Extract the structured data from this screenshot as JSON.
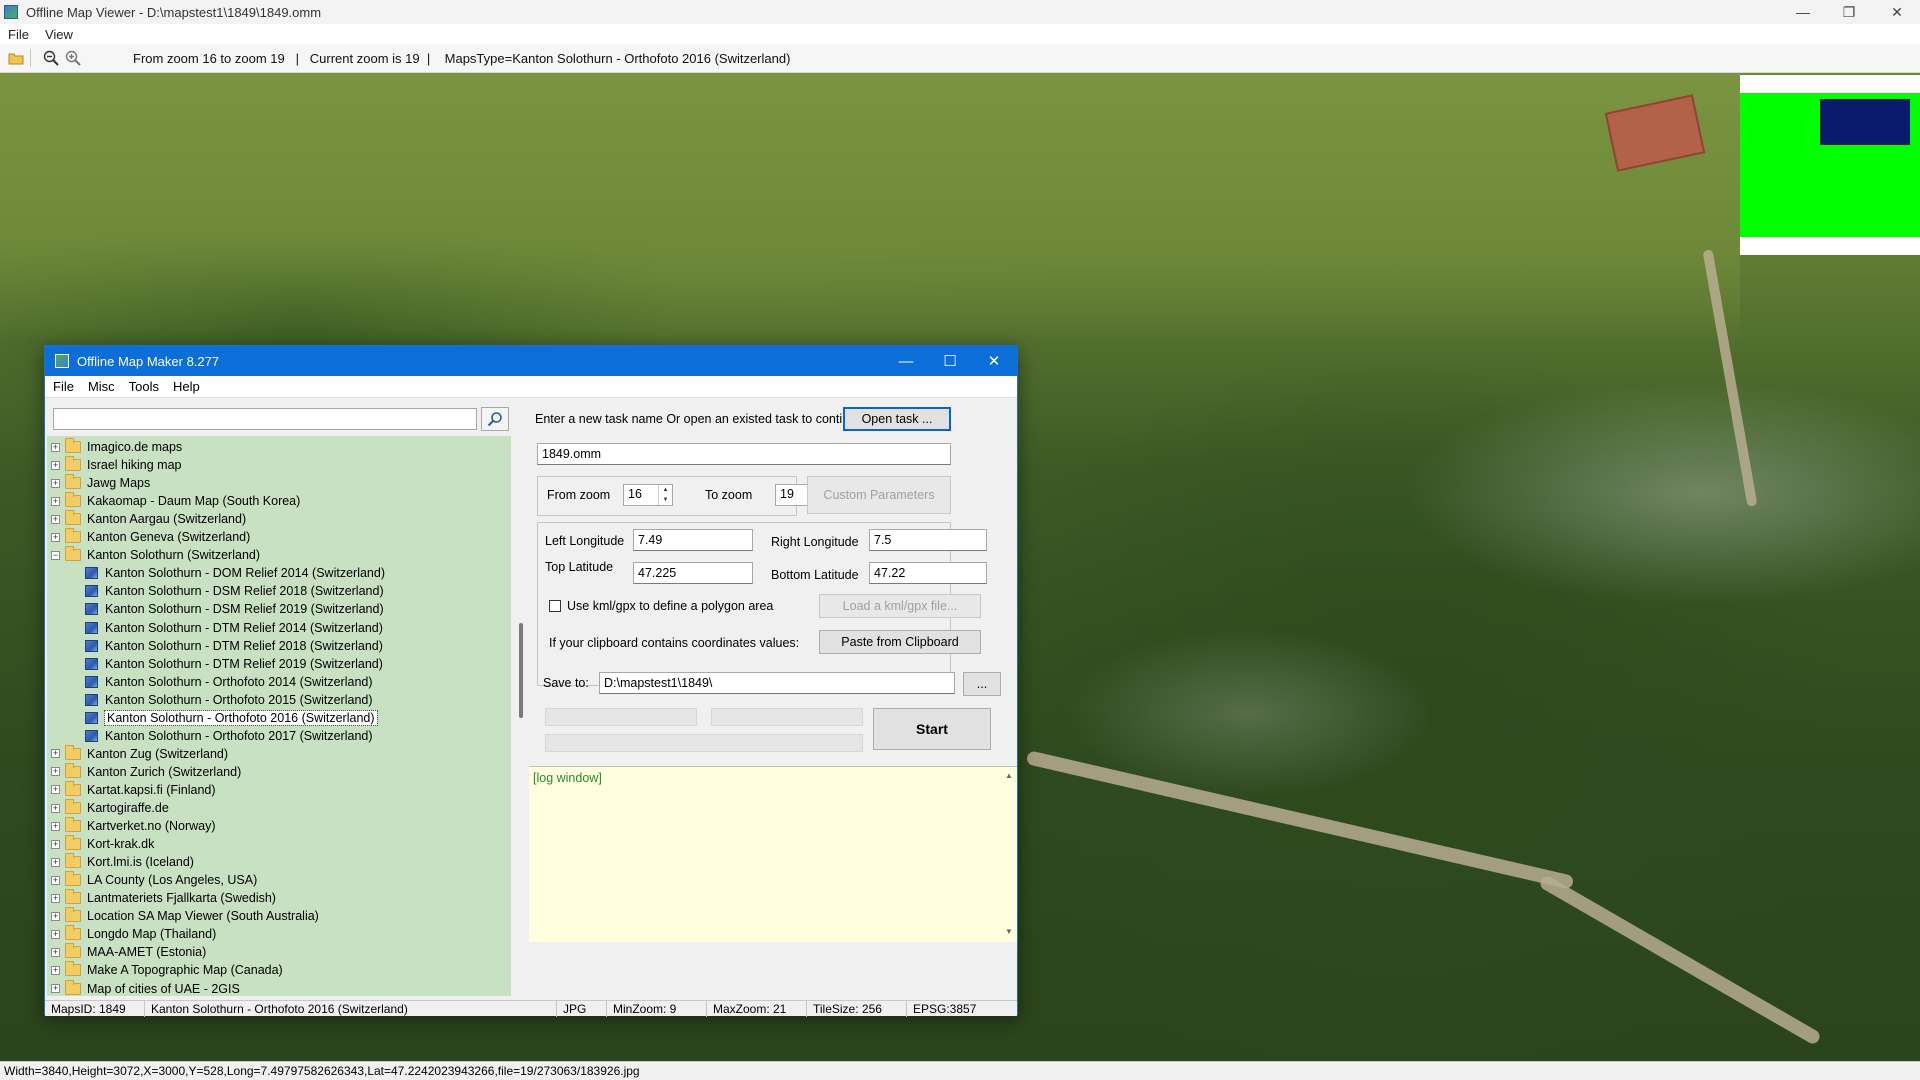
{
  "window": {
    "title": "Offline Map Viewer - D:\\mapstest1\\1849\\1849.omm",
    "menu": [
      "File",
      "View"
    ]
  },
  "toolbar": {
    "icons": [
      "open-folder-icon",
      "zoom-out-icon",
      "zoom-in-icon"
    ],
    "status_text": "From zoom 16 to zoom 19   |   Current zoom is 19  |    MapsType=Kanton Solothurn - Orthofoto 2016 (Switzerland)"
  },
  "map": {
    "minimap_colors": {
      "frame": "#00ff00",
      "viewport": "#0c1a6e"
    }
  },
  "statusbar": {
    "text": "Width=3840,Height=3072,X=3000,Y=528,Long=7.49797582626343,Lat=47.2242023943266,file=19/273063/183926.jpg"
  },
  "dialog": {
    "title": "Offline Map Maker 8.277",
    "menu": [
      "File",
      "Misc",
      "Tools",
      "Help"
    ],
    "search": {
      "value": "",
      "placeholder": ""
    },
    "tree": [
      {
        "label": "Imagico.de maps",
        "type": "folder",
        "level": 0,
        "expanded": false
      },
      {
        "label": "Israel hiking map",
        "type": "folder",
        "level": 0,
        "expanded": false
      },
      {
        "label": "Jawg Maps",
        "type": "folder",
        "level": 0,
        "expanded": false
      },
      {
        "label": "Kakaomap - Daum Map (South Korea)",
        "type": "folder",
        "level": 0,
        "expanded": false
      },
      {
        "label": "Kanton Aargau (Switzerland)",
        "type": "folder",
        "level": 0,
        "expanded": false
      },
      {
        "label": "Kanton Geneva (Switzerland)",
        "type": "folder",
        "level": 0,
        "expanded": false
      },
      {
        "label": "Kanton Solothurn (Switzerland)",
        "type": "folder",
        "level": 0,
        "expanded": true
      },
      {
        "label": "Kanton Solothurn - DOM Relief 2014 (Switzerland)",
        "type": "map",
        "level": 1
      },
      {
        "label": "Kanton Solothurn - DSM Relief 2018 (Switzerland)",
        "type": "map",
        "level": 1
      },
      {
        "label": "Kanton Solothurn - DSM Relief 2019 (Switzerland)",
        "type": "map",
        "level": 1
      },
      {
        "label": "Kanton Solothurn - DTM Relief 2014 (Switzerland)",
        "type": "map",
        "level": 1
      },
      {
        "label": "Kanton Solothurn - DTM Relief 2018 (Switzerland)",
        "type": "map",
        "level": 1
      },
      {
        "label": "Kanton Solothurn - DTM Relief 2019 (Switzerland)",
        "type": "map",
        "level": 1
      },
      {
        "label": "Kanton Solothurn - Orthofoto 2014 (Switzerland)",
        "type": "map",
        "level": 1
      },
      {
        "label": "Kanton Solothurn - Orthofoto 2015 (Switzerland)",
        "type": "map",
        "level": 1
      },
      {
        "label": "Kanton Solothurn - Orthofoto 2016 (Switzerland)",
        "type": "map",
        "level": 1,
        "selected": true
      },
      {
        "label": "Kanton Solothurn - Orthofoto 2017 (Switzerland)",
        "type": "map",
        "level": 1
      },
      {
        "label": "Kanton Zug (Switzerland)",
        "type": "folder",
        "level": 0,
        "expanded": false
      },
      {
        "label": "Kanton Zurich (Switzerland)",
        "type": "folder",
        "level": 0,
        "expanded": false
      },
      {
        "label": "Kartat.kapsi.fi (Finland)",
        "type": "folder",
        "level": 0,
        "expanded": false
      },
      {
        "label": "Kartogiraffe.de",
        "type": "folder",
        "level": 0,
        "expanded": false
      },
      {
        "label": "Kartverket.no (Norway)",
        "type": "folder",
        "level": 0,
        "expanded": false
      },
      {
        "label": "Kort-krak.dk",
        "type": "folder",
        "level": 0,
        "expanded": false
      },
      {
        "label": "Kort.lmi.is (Iceland)",
        "type": "folder",
        "level": 0,
        "expanded": false
      },
      {
        "label": "LA County (Los Angeles, USA)",
        "type": "folder",
        "level": 0,
        "expanded": false
      },
      {
        "label": "Lantmateriets Fjallkarta (Swedish)",
        "type": "folder",
        "level": 0,
        "expanded": false
      },
      {
        "label": "Location SA Map Viewer (South Australia)",
        "type": "folder",
        "level": 0,
        "expanded": false
      },
      {
        "label": "Longdo Map (Thailand)",
        "type": "folder",
        "level": 0,
        "expanded": false
      },
      {
        "label": "MAA-AMET (Estonia)",
        "type": "folder",
        "level": 0,
        "expanded": false
      },
      {
        "label": "Make A Topographic Map (Canada)",
        "type": "folder",
        "level": 0,
        "expanded": false
      },
      {
        "label": "Map of cities of UAE - 2GIS",
        "type": "folder",
        "level": 0,
        "expanded": false
      }
    ],
    "task": {
      "prompt": "Enter a new task name Or open an existed task to continue:",
      "open_button": "Open task ...",
      "name_value": "1849.omm"
    },
    "zoom": {
      "from_label": "From zoom",
      "from_value": "16",
      "to_label": "To zoom",
      "to_value": "19",
      "custom_button": "Custom Parameters"
    },
    "coords": {
      "left_label": "Left Longitude",
      "left_value": "7.49",
      "right_label": "Right Longitude",
      "right_value": "7.5",
      "top_label": "Top Latitude",
      "top_value": "47.225",
      "bottom_label": "Bottom Latitude",
      "bottom_value": "47.22",
      "kml_label": "Use kml/gpx to define a polygon area",
      "kml_button": "Load a kml/gpx file...",
      "clipboard_label": "If your clipboard contains coordinates values:",
      "clipboard_button": "Paste from Clipboard"
    },
    "save": {
      "label": "Save to:",
      "value": "D:\\mapstest1\\1849\\",
      "browse_button": "...",
      "start_button": "Start"
    },
    "log": {
      "text": "[log window]"
    },
    "status": {
      "maps_id": "MapsID: 1849",
      "map_name": "Kanton Solothurn - Orthofoto 2016 (Switzerland)",
      "format": "JPG",
      "min_zoom": "MinZoom: 9",
      "max_zoom": "MaxZoom: 21",
      "tile_size": "TileSize: 256",
      "epsg": "EPSG:3857"
    }
  }
}
